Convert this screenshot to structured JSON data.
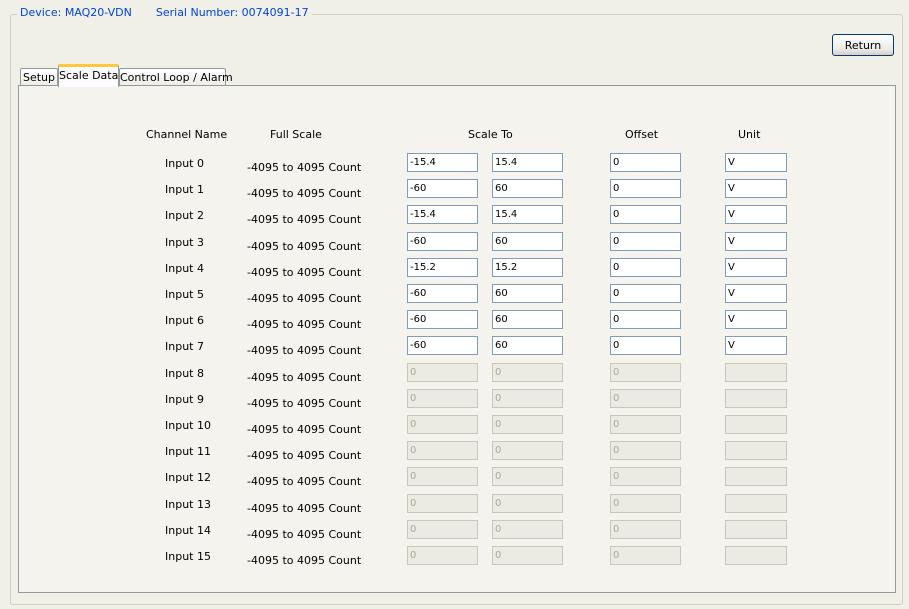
{
  "device_label": "Device: MAQ20-VDN",
  "serial_label": "Serial Number: 0074091-17",
  "return_label": "Return",
  "tabs": [
    {
      "label": "Setup",
      "active": false
    },
    {
      "label": "Scale Data",
      "active": true
    },
    {
      "label": "Control Loop / Alarm",
      "active": false
    }
  ],
  "columns": {
    "channel_name": "Channel Name",
    "full_scale": "Full Scale",
    "scale_to": "Scale To",
    "offset": "Offset",
    "unit": "Unit"
  },
  "rows": [
    {
      "name": "Input 0",
      "full_scale": "-4095 to 4095 Count",
      "scale_low": "-15.4",
      "scale_high": "15.4",
      "offset": "0",
      "unit": "V",
      "enabled": true
    },
    {
      "name": "Input 1",
      "full_scale": "-4095 to 4095 Count",
      "scale_low": "-60",
      "scale_high": "60",
      "offset": "0",
      "unit": "V",
      "enabled": true
    },
    {
      "name": "Input 2",
      "full_scale": "-4095 to 4095 Count",
      "scale_low": "-15.4",
      "scale_high": "15.4",
      "offset": "0",
      "unit": "V",
      "enabled": true
    },
    {
      "name": "Input 3",
      "full_scale": "-4095 to 4095 Count",
      "scale_low": "-60",
      "scale_high": "60",
      "offset": "0",
      "unit": "V",
      "enabled": true
    },
    {
      "name": "Input 4",
      "full_scale": "-4095 to 4095 Count",
      "scale_low": "-15.2",
      "scale_high": "15.2",
      "offset": "0",
      "unit": "V",
      "enabled": true
    },
    {
      "name": "Input 5",
      "full_scale": "-4095 to 4095 Count",
      "scale_low": "-60",
      "scale_high": "60",
      "offset": "0",
      "unit": "V",
      "enabled": true
    },
    {
      "name": "Input 6",
      "full_scale": "-4095 to 4095 Count",
      "scale_low": "-60",
      "scale_high": "60",
      "offset": "0",
      "unit": "V",
      "enabled": true
    },
    {
      "name": "Input 7",
      "full_scale": "-4095 to 4095 Count",
      "scale_low": "-60",
      "scale_high": "60",
      "offset": "0",
      "unit": "V",
      "enabled": true
    },
    {
      "name": "Input 8",
      "full_scale": "-4095 to 4095 Count",
      "scale_low": "0",
      "scale_high": "0",
      "offset": "0",
      "unit": "",
      "enabled": false
    },
    {
      "name": "Input 9",
      "full_scale": "-4095 to 4095 Count",
      "scale_low": "0",
      "scale_high": "0",
      "offset": "0",
      "unit": "",
      "enabled": false
    },
    {
      "name": "Input 10",
      "full_scale": "-4095 to 4095 Count",
      "scale_low": "0",
      "scale_high": "0",
      "offset": "0",
      "unit": "",
      "enabled": false
    },
    {
      "name": "Input 11",
      "full_scale": "-4095 to 4095 Count",
      "scale_low": "0",
      "scale_high": "0",
      "offset": "0",
      "unit": "",
      "enabled": false
    },
    {
      "name": "Input 12",
      "full_scale": "-4095 to 4095 Count",
      "scale_low": "0",
      "scale_high": "0",
      "offset": "0",
      "unit": "",
      "enabled": false
    },
    {
      "name": "Input 13",
      "full_scale": "-4095 to 4095 Count",
      "scale_low": "0",
      "scale_high": "0",
      "offset": "0",
      "unit": "",
      "enabled": false
    },
    {
      "name": "Input 14",
      "full_scale": "-4095 to 4095 Count",
      "scale_low": "0",
      "scale_high": "0",
      "offset": "0",
      "unit": "",
      "enabled": false
    },
    {
      "name": "Input 15",
      "full_scale": "-4095 to 4095 Count",
      "scale_low": "0",
      "scale_high": "0",
      "offset": "0",
      "unit": "",
      "enabled": false
    }
  ]
}
